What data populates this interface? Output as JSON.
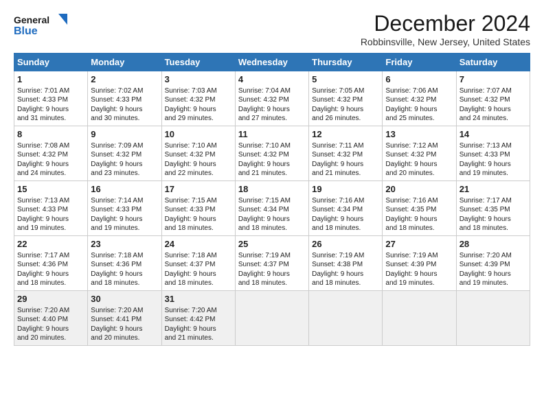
{
  "header": {
    "logo_general": "General",
    "logo_blue": "Blue",
    "title": "December 2024",
    "location": "Robbinsville, New Jersey, United States"
  },
  "calendar": {
    "days_of_week": [
      "Sunday",
      "Monday",
      "Tuesday",
      "Wednesday",
      "Thursday",
      "Friday",
      "Saturday"
    ],
    "weeks": [
      [
        {
          "num": "1",
          "info": "Sunrise: 7:01 AM\nSunset: 4:33 PM\nDaylight: 9 hours\nand 31 minutes."
        },
        {
          "num": "2",
          "info": "Sunrise: 7:02 AM\nSunset: 4:33 PM\nDaylight: 9 hours\nand 30 minutes."
        },
        {
          "num": "3",
          "info": "Sunrise: 7:03 AM\nSunset: 4:32 PM\nDaylight: 9 hours\nand 29 minutes."
        },
        {
          "num": "4",
          "info": "Sunrise: 7:04 AM\nSunset: 4:32 PM\nDaylight: 9 hours\nand 27 minutes."
        },
        {
          "num": "5",
          "info": "Sunrise: 7:05 AM\nSunset: 4:32 PM\nDaylight: 9 hours\nand 26 minutes."
        },
        {
          "num": "6",
          "info": "Sunrise: 7:06 AM\nSunset: 4:32 PM\nDaylight: 9 hours\nand 25 minutes."
        },
        {
          "num": "7",
          "info": "Sunrise: 7:07 AM\nSunset: 4:32 PM\nDaylight: 9 hours\nand 24 minutes."
        }
      ],
      [
        {
          "num": "8",
          "info": "Sunrise: 7:08 AM\nSunset: 4:32 PM\nDaylight: 9 hours\nand 24 minutes."
        },
        {
          "num": "9",
          "info": "Sunrise: 7:09 AM\nSunset: 4:32 PM\nDaylight: 9 hours\nand 23 minutes."
        },
        {
          "num": "10",
          "info": "Sunrise: 7:10 AM\nSunset: 4:32 PM\nDaylight: 9 hours\nand 22 minutes."
        },
        {
          "num": "11",
          "info": "Sunrise: 7:10 AM\nSunset: 4:32 PM\nDaylight: 9 hours\nand 21 minutes."
        },
        {
          "num": "12",
          "info": "Sunrise: 7:11 AM\nSunset: 4:32 PM\nDaylight: 9 hours\nand 21 minutes."
        },
        {
          "num": "13",
          "info": "Sunrise: 7:12 AM\nSunset: 4:32 PM\nDaylight: 9 hours\nand 20 minutes."
        },
        {
          "num": "14",
          "info": "Sunrise: 7:13 AM\nSunset: 4:33 PM\nDaylight: 9 hours\nand 19 minutes."
        }
      ],
      [
        {
          "num": "15",
          "info": "Sunrise: 7:13 AM\nSunset: 4:33 PM\nDaylight: 9 hours\nand 19 minutes."
        },
        {
          "num": "16",
          "info": "Sunrise: 7:14 AM\nSunset: 4:33 PM\nDaylight: 9 hours\nand 19 minutes."
        },
        {
          "num": "17",
          "info": "Sunrise: 7:15 AM\nSunset: 4:33 PM\nDaylight: 9 hours\nand 18 minutes."
        },
        {
          "num": "18",
          "info": "Sunrise: 7:15 AM\nSunset: 4:34 PM\nDaylight: 9 hours\nand 18 minutes."
        },
        {
          "num": "19",
          "info": "Sunrise: 7:16 AM\nSunset: 4:34 PM\nDaylight: 9 hours\nand 18 minutes."
        },
        {
          "num": "20",
          "info": "Sunrise: 7:16 AM\nSunset: 4:35 PM\nDaylight: 9 hours\nand 18 minutes."
        },
        {
          "num": "21",
          "info": "Sunrise: 7:17 AM\nSunset: 4:35 PM\nDaylight: 9 hours\nand 18 minutes."
        }
      ],
      [
        {
          "num": "22",
          "info": "Sunrise: 7:17 AM\nSunset: 4:36 PM\nDaylight: 9 hours\nand 18 minutes."
        },
        {
          "num": "23",
          "info": "Sunrise: 7:18 AM\nSunset: 4:36 PM\nDaylight: 9 hours\nand 18 minutes."
        },
        {
          "num": "24",
          "info": "Sunrise: 7:18 AM\nSunset: 4:37 PM\nDaylight: 9 hours\nand 18 minutes."
        },
        {
          "num": "25",
          "info": "Sunrise: 7:19 AM\nSunset: 4:37 PM\nDaylight: 9 hours\nand 18 minutes."
        },
        {
          "num": "26",
          "info": "Sunrise: 7:19 AM\nSunset: 4:38 PM\nDaylight: 9 hours\nand 18 minutes."
        },
        {
          "num": "27",
          "info": "Sunrise: 7:19 AM\nSunset: 4:39 PM\nDaylight: 9 hours\nand 19 minutes."
        },
        {
          "num": "28",
          "info": "Sunrise: 7:20 AM\nSunset: 4:39 PM\nDaylight: 9 hours\nand 19 minutes."
        }
      ],
      [
        {
          "num": "29",
          "info": "Sunrise: 7:20 AM\nSunset: 4:40 PM\nDaylight: 9 hours\nand 20 minutes."
        },
        {
          "num": "30",
          "info": "Sunrise: 7:20 AM\nSunset: 4:41 PM\nDaylight: 9 hours\nand 20 minutes."
        },
        {
          "num": "31",
          "info": "Sunrise: 7:20 AM\nSunset: 4:42 PM\nDaylight: 9 hours\nand 21 minutes."
        },
        null,
        null,
        null,
        null
      ]
    ]
  }
}
